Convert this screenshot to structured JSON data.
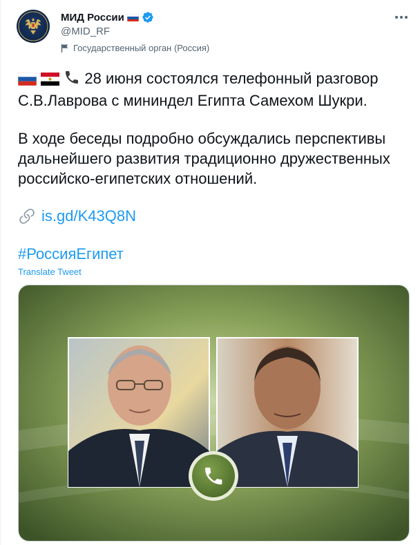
{
  "account": {
    "name": "МИД России",
    "handle": "@MID_RF",
    "label": "Государственный орган (Россия)"
  },
  "tweet": {
    "line1": "28 июня состоялся телефонный разговор С.В.Лаврова с мининдел Египта Самехом Шукри.",
    "paragraph2": "В ходе беседы подробно обсуждались перспективы дальнейшего развития традиционно дружественных российско-египетских отношений.",
    "link": "is.gd/K43Q8N",
    "hashtag": "#РоссияЕгипет",
    "translate": "Translate Tweet"
  },
  "colors": {
    "link": "#1d9bf0",
    "verified": "#1d9bf0",
    "media_green": "#7a9a4a",
    "phone_badge": "#5a7a3a"
  },
  "icons": [
    "ministry-emblem-icon",
    "russia-flag-icon",
    "verified-badge-icon",
    "more-options-icon",
    "gov-flag-icon",
    "egypt-flag-icon",
    "phone-icon",
    "link-icon",
    "phone-call-badge-icon"
  ]
}
